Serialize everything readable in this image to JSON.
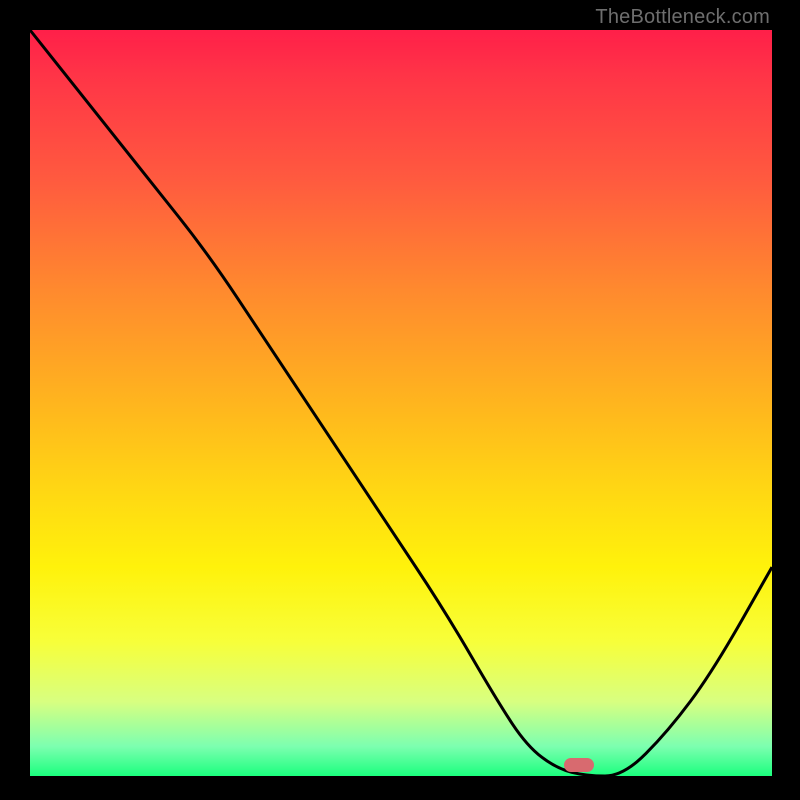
{
  "watermark": "TheBottleneck.com",
  "colors": {
    "background": "#000000",
    "curve_stroke": "#000000",
    "marker_fill": "#d86a6f"
  },
  "chart_data": {
    "type": "line",
    "title": "",
    "xlabel": "",
    "ylabel": "",
    "xlim": [
      0,
      100
    ],
    "ylim": [
      0,
      100
    ],
    "grid": false,
    "legend": false,
    "series": [
      {
        "name": "bottleneck-curve",
        "x": [
          0,
          8,
          16,
          24,
          32,
          40,
          48,
          56,
          63,
          67,
          71,
          75,
          80,
          86,
          92,
          100
        ],
        "values": [
          100,
          90,
          80,
          70,
          58,
          46,
          34,
          22,
          10,
          4,
          1,
          0,
          0,
          6,
          14,
          28
        ]
      }
    ],
    "annotations": [
      {
        "name": "selected-marker",
        "x": 74,
        "y": 1.5
      }
    ]
  }
}
